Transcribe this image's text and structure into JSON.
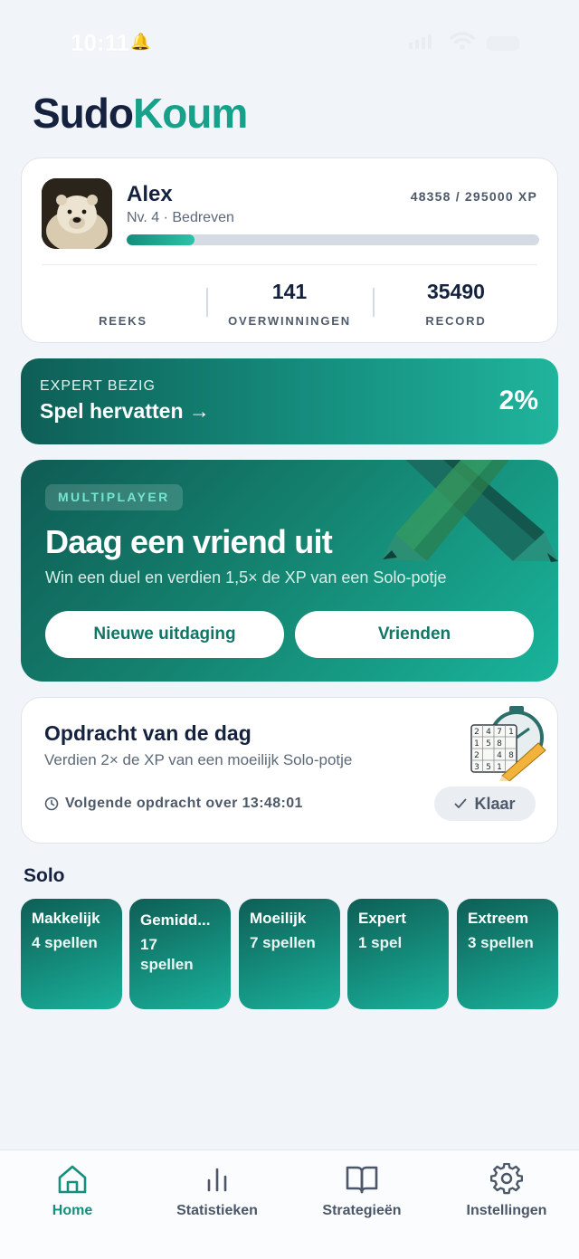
{
  "status_bar": {
    "time": "10:11"
  },
  "app": {
    "logo_part1": "Sudo",
    "logo_part2": "Koum"
  },
  "profile": {
    "name": "Alex",
    "level": "Nv. 4 · Bedreven",
    "xp": "48358 / 295000 XP",
    "xp_progress_fraction": 0.164,
    "stats": [
      {
        "value": "",
        "label": "REEKS"
      },
      {
        "value": "141",
        "label": "OVERWINNINGEN"
      },
      {
        "value": "35490",
        "label": "RECORD"
      }
    ]
  },
  "resume": {
    "kicker": "EXPERT BEZIG",
    "title": "Spel hervatten →",
    "percent": "2%"
  },
  "multiplayer": {
    "badge": "MULTIPLAYER",
    "title": "Daag een vriend uit",
    "subtitle": "Win een duel en verdien 1,5× de XP van een Solo-potje",
    "btn_new": "Nieuwe uitdaging",
    "btn_friends": "Vrienden"
  },
  "daily": {
    "title": "Opdracht van de dag",
    "subtitle": "Verdien 2× de XP van een moeilijk Solo-potje",
    "timer": "Volgende opdracht over 13:48:01",
    "done_label": "Klaar",
    "grid_digits": [
      "2",
      "4",
      "7",
      "1",
      "1",
      "5",
      "8",
      "2",
      "4",
      "8",
      "3",
      "5",
      "1"
    ]
  },
  "solo": {
    "heading": "Solo",
    "tiles": [
      {
        "name": "Makkelijk",
        "count": "4 spellen"
      },
      {
        "name": "Gemidd...",
        "count": "17 spellen"
      },
      {
        "name": "Moeilijk",
        "count": "7 spellen"
      },
      {
        "name": "Expert",
        "count": "1 spel"
      },
      {
        "name": "Extreem",
        "count": "3 spellen"
      }
    ]
  },
  "nav": {
    "items": [
      {
        "label": "Home",
        "icon": "home-icon",
        "active": true
      },
      {
        "label": "Statistieken",
        "icon": "bar-chart-icon",
        "active": false
      },
      {
        "label": "Strategieën",
        "icon": "book-icon",
        "active": false
      },
      {
        "label": "Instellingen",
        "icon": "gear-icon",
        "active": false
      }
    ],
    "active_color": "#168e7e",
    "inactive_color": "#4b5668"
  },
  "colors": {
    "accent": "#17a08a",
    "navy": "#15223f",
    "background": "#f1f4f8"
  }
}
